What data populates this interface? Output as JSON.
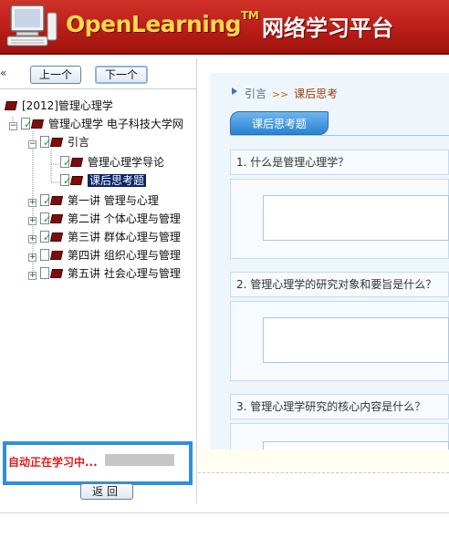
{
  "header": {
    "brand": "OpenLearning",
    "trademark": "TM",
    "title_cn": "网络学习平台"
  },
  "nav": {
    "collapse": "«",
    "prev": "上一个",
    "next": "下一个"
  },
  "tree": {
    "root": "[2012]管理心理学",
    "course": "管理心理学 电子科技大学网",
    "intro": "引言",
    "intro_children": [
      "管理心理学导论",
      "课后思考题"
    ],
    "chapters": [
      "第一讲   管理与心理",
      "第二讲 个体心理与管理",
      "第三讲   群体心理与管理",
      "第四讲   组织心理与管理",
      "第五讲   社会心理与管理"
    ]
  },
  "status": {
    "text": "自动正在学习中..."
  },
  "return_label": "返回",
  "content": {
    "breadcrumb": {
      "parent": "引言",
      "sep": ">>",
      "current": "课后思考"
    },
    "tab": "课后思考题",
    "questions": [
      "1. 什么是管理心理学？",
      "2. 管理心理学的研究对象和要旨是什么？",
      "3. 管理心理学研究的核心内容是什么？"
    ]
  },
  "colors": {
    "header": "#b81d16",
    "brand": "#ffd94a",
    "status_border": "#2f8fe0",
    "status_text": "#e01a1a",
    "selected": "#0a246a"
  }
}
